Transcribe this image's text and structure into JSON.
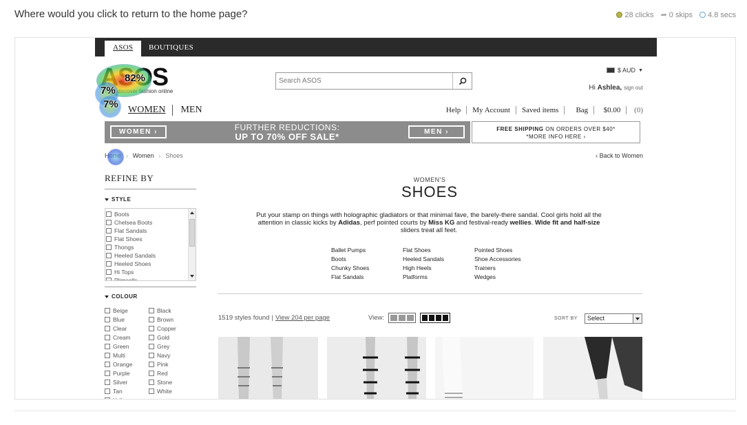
{
  "task": {
    "question": "Where would you click to return to the home page?",
    "clicks": "28 clicks",
    "skips": "0 skips",
    "time": "4.8 secs"
  },
  "heatmap": {
    "labels": [
      "82%",
      "7%",
      "7%"
    ]
  },
  "site": {
    "tabs": [
      "ASOS",
      "BOUTIQUES"
    ],
    "logo": "ASOS",
    "logo_tagline": "discover fashion online",
    "search_placeholder": "Search ASOS",
    "currency": "$ AUD",
    "greeting_prefix": "Hi",
    "user_name": "Ashlea,",
    "sign_out": "sign out",
    "gender": [
      "WOMEN",
      "MEN"
    ],
    "account": {
      "help": "Help",
      "my_account": "My Account",
      "saved": "Saved items",
      "bag": "Bag",
      "bag_value": "$0.00",
      "bag_count": "(0)"
    },
    "promo": {
      "women_btn": "WOMEN ›",
      "men_btn": "MEN ›",
      "line1": "FURTHER REDUCTIONS:",
      "line2": "UP TO 70% OFF SALE*"
    },
    "shipping": {
      "bold": "FREE SHIPPING",
      "rest": "ON ORDERS OVER $40*",
      "more": "*MORE INFO HERE ›"
    },
    "breadcrumb": [
      "Home",
      "Women",
      "Shoes"
    ],
    "back_link": "‹ Back to Women",
    "refine_title": "REFINE BY",
    "style_heading": "STYLE",
    "style_items": [
      "Boots",
      "Chelsea Boots",
      "Flat Sandals",
      "Flat Shoes",
      "Thongs",
      "Heeled Sandals",
      "Heeled Shoes",
      "Hi Tops",
      "Plimsolls"
    ],
    "colour_heading": "COLOUR",
    "colours": [
      "Beige",
      "Black",
      "Blue",
      "Brown",
      "Clear",
      "Copper",
      "Cream",
      "Gold",
      "Green",
      "Grey",
      "Multi",
      "Navy",
      "Orange",
      "Pink",
      "Purple",
      "Red",
      "Silver",
      "Stone",
      "Tan",
      "White",
      "Yellow"
    ],
    "page_super": "WOMEN'S",
    "page_title": "SHOES",
    "desc": {
      "p1": "Put your stamp on things with holographic gladiators or that minimal fave, the barely-there sandal. Cool girls hold all the attention in classic kicks by ",
      "b1": "Adidas",
      "p2": ", perf pointed courts by ",
      "b2": "Miss KG",
      "p3": " and festival-ready ",
      "b3": "wellies",
      "p4": ". ",
      "b4": "Wide fit and half-size",
      "p5": " sliders treat all feet."
    },
    "category_links": [
      "Ballet Pumps",
      "Flat Shoes",
      "Pointed Shoes",
      "Boots",
      "Heeled Sandals",
      "Shoe Accessories",
      "Chunky Shoes",
      "High Heels",
      "Trainers",
      "Flat Sandals",
      "Platforms",
      "Wedges"
    ],
    "results": {
      "found": "1519 styles found",
      "per_page": "View 204 per page"
    },
    "view_label": "View:",
    "sort_label": "SORT BY",
    "sort_value": "Select"
  }
}
